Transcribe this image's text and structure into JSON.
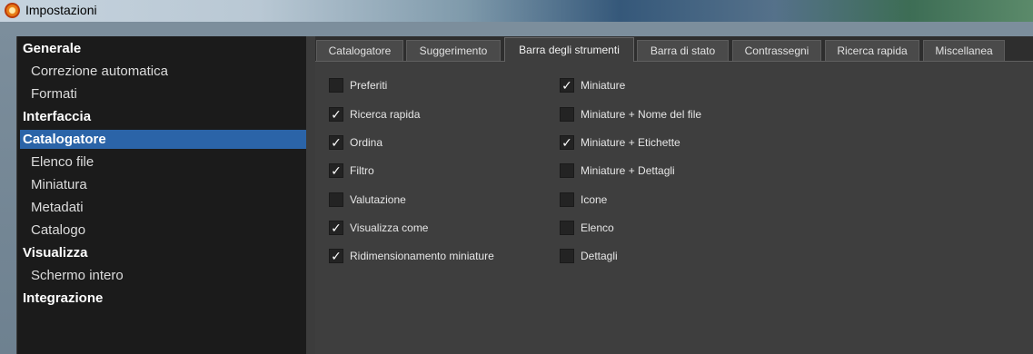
{
  "window": {
    "title": "Impostazioni"
  },
  "sidebar": {
    "items": [
      {
        "label": "Generale",
        "level": "category",
        "selected": false
      },
      {
        "label": "Correzione automatica",
        "level": "sub",
        "selected": false
      },
      {
        "label": "Formati",
        "level": "sub",
        "selected": false
      },
      {
        "label": "Interfaccia",
        "level": "category",
        "selected": false
      },
      {
        "label": "Catalogatore",
        "level": "category",
        "selected": true
      },
      {
        "label": "Elenco file",
        "level": "sub",
        "selected": false
      },
      {
        "label": "Miniatura",
        "level": "sub",
        "selected": false
      },
      {
        "label": "Metadati",
        "level": "sub",
        "selected": false
      },
      {
        "label": "Catalogo",
        "level": "sub",
        "selected": false
      },
      {
        "label": "Visualizza",
        "level": "category",
        "selected": false
      },
      {
        "label": "Schermo intero",
        "level": "sub",
        "selected": false
      },
      {
        "label": "Integrazione",
        "level": "category",
        "selected": false
      }
    ]
  },
  "tabs": [
    {
      "label": "Catalogatore",
      "active": false
    },
    {
      "label": "Suggerimento",
      "active": false
    },
    {
      "label": "Barra degli strumenti",
      "active": true
    },
    {
      "label": "Barra di stato",
      "active": false
    },
    {
      "label": "Contrassegni",
      "active": false
    },
    {
      "label": "Ricerca rapida",
      "active": false
    },
    {
      "label": "Miscellanea",
      "active": false
    }
  ],
  "options": {
    "left": [
      {
        "label": "Preferiti",
        "checked": false
      },
      {
        "label": "Ricerca rapida",
        "checked": true
      },
      {
        "label": "Ordina",
        "checked": true
      },
      {
        "label": "Filtro",
        "checked": true
      },
      {
        "label": "Valutazione",
        "checked": false
      },
      {
        "label": "Visualizza come",
        "checked": true
      },
      {
        "label": "Ridimensionamento miniature",
        "checked": true
      }
    ],
    "right": [
      {
        "label": "Miniature",
        "checked": true
      },
      {
        "label": "Miniature + Nome del file",
        "checked": false
      },
      {
        "label": "Miniature + Etichette",
        "checked": true
      },
      {
        "label": "Miniature + Dettagli",
        "checked": false
      },
      {
        "label": "Icone",
        "checked": false
      },
      {
        "label": "Elenco",
        "checked": false
      },
      {
        "label": "Dettagli",
        "checked": false
      }
    ]
  },
  "check_glyph": "✓",
  "colors": {
    "selection": "#2b64a8",
    "sidebar_bg": "#1b1b1b",
    "panel_bg": "#3e3e3e"
  }
}
